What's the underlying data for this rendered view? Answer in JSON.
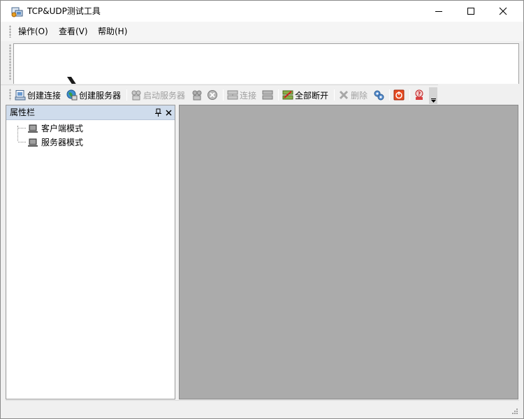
{
  "window": {
    "title": "TCP&UDP测试工具",
    "app_icon": "network-app-icon"
  },
  "menu": {
    "items": [
      {
        "label": "操作(O)"
      },
      {
        "label": "查看(V)"
      },
      {
        "label": "帮助(H)"
      }
    ]
  },
  "toolbar": {
    "buttons": [
      {
        "label": "创建连接",
        "icon": "new-connection-icon",
        "enabled": true
      },
      {
        "label": "创建服务器",
        "icon": "globe-server-icon",
        "enabled": true
      },
      {
        "label": "启动服务器",
        "icon": "start-server-icon",
        "enabled": false
      },
      {
        "label": "",
        "icon": "stop-server-icon",
        "enabled": false
      },
      {
        "label": "",
        "icon": "cancel-circle-icon",
        "enabled": false
      },
      {
        "label": "连接",
        "icon": "connect-icon",
        "enabled": false
      },
      {
        "label": "",
        "icon": "disconnect-icon",
        "enabled": false
      },
      {
        "label": "全部断开",
        "icon": "disconnect-all-icon",
        "enabled": true
      },
      {
        "label": "删除",
        "icon": "delete-x-icon",
        "enabled": false
      },
      {
        "label": "",
        "icon": "settings-gear-icon",
        "enabled": true
      },
      {
        "label": "",
        "icon": "power-icon",
        "enabled": true
      },
      {
        "label": "",
        "icon": "help-icon",
        "enabled": true
      }
    ]
  },
  "property_panel": {
    "title": "属性栏",
    "tree": [
      {
        "label": "客户端模式"
      },
      {
        "label": "服务器模式"
      }
    ]
  },
  "statusbar": {
    "text": ""
  }
}
